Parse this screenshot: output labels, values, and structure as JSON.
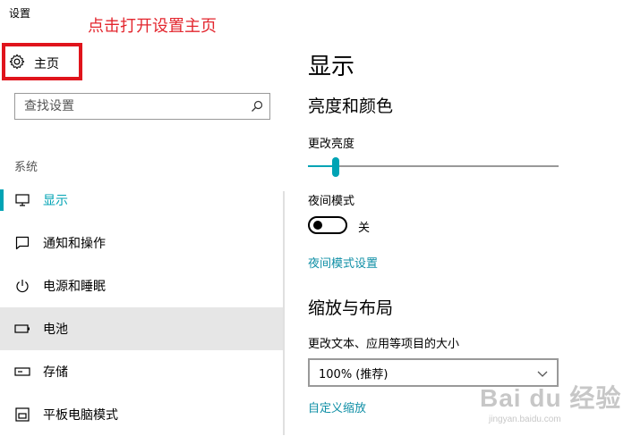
{
  "window": {
    "title": "设置"
  },
  "annotation": {
    "text": "点击打开设置主页",
    "color": "#e3262e"
  },
  "sidebar": {
    "home_label": "主页",
    "search": {
      "placeholder": "查找设置"
    },
    "section_label": "系统",
    "items": [
      {
        "label": "显示",
        "icon": "monitor-icon",
        "selected": true
      },
      {
        "label": "通知和操作",
        "icon": "notification-icon"
      },
      {
        "label": "电源和睡眠",
        "icon": "power-icon"
      },
      {
        "label": "电池",
        "icon": "battery-icon",
        "hovered": true
      },
      {
        "label": "存储",
        "icon": "storage-icon"
      },
      {
        "label": "平板电脑模式",
        "icon": "tablet-mode-icon"
      }
    ]
  },
  "main": {
    "title": "显示",
    "brightness": {
      "heading": "亮度和颜色",
      "slider_label": "更改亮度",
      "value_fraction": 0.11
    },
    "night_mode": {
      "label": "夜间模式",
      "state_label": "关",
      "on": false,
      "link": "夜间模式设置"
    },
    "scale": {
      "heading": "缩放与布局",
      "label": "更改文本、应用等项目的大小",
      "selected": "100% (推荐)",
      "link": "自定义缩放"
    }
  },
  "watermark": {
    "text": "Bai du 经验",
    "subtext": "jingyan.baidu.com"
  },
  "colors": {
    "accent": "#00a3b4",
    "link": "#0f8fa6",
    "highlight": "#e0141c",
    "hover": "#e6e6e6"
  }
}
